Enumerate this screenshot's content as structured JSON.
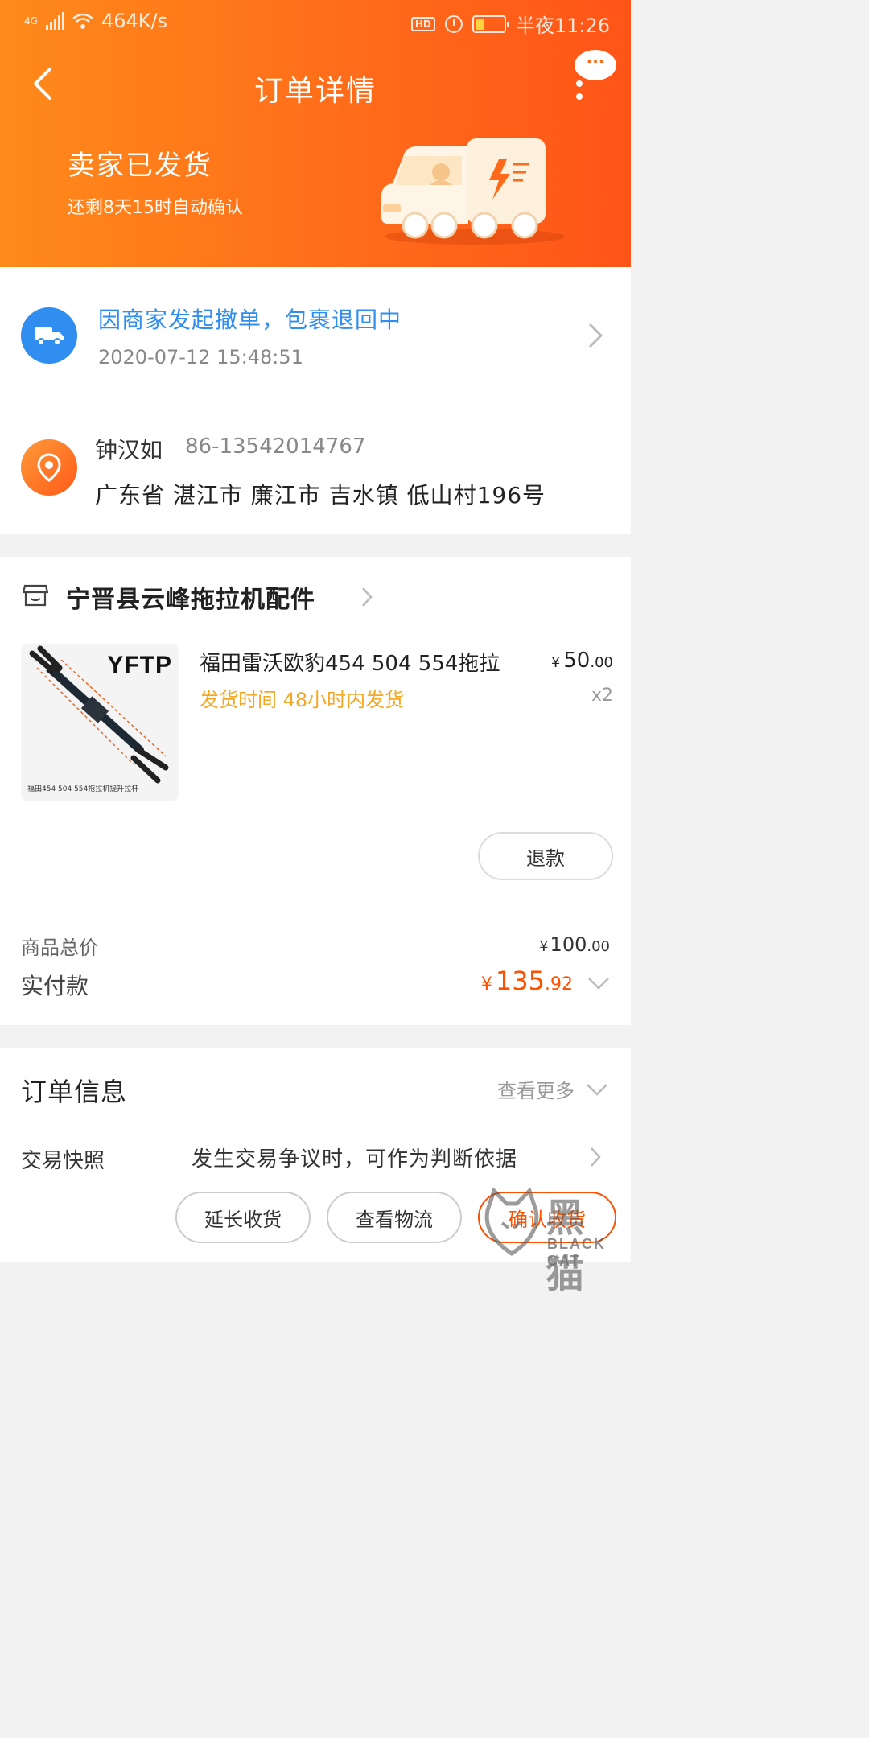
{
  "status_bar": {
    "network": "4G",
    "speed": "464K/s",
    "hd": "HD",
    "time": "半夜11:26"
  },
  "nav": {
    "title": "订单详情",
    "more_bubble": "···"
  },
  "shipping": {
    "status": "卖家已发货",
    "auto_confirm": "还剩8天15时自动确认"
  },
  "logistics": {
    "message": "因商家发起撤单，包裹退回中",
    "time": "2020-07-12 15:48:51"
  },
  "receiver": {
    "name": "钟汉如",
    "phone": "86-13542014767",
    "address": "广东省 湛江市 廉江市 吉水镇 低山村196号"
  },
  "shop": {
    "name": "宁晋县云峰拖拉机配件"
  },
  "product": {
    "image_brand": "YFTP",
    "image_caption": "福田454 504 554拖拉机提升拉杆",
    "name": "福田雷沃欧豹454 504 554拖拉",
    "ship_time": "发货时间 48小时内发货",
    "price_currency": "¥",
    "price_int": "50",
    "price_dec": ".00",
    "quantity": "x2"
  },
  "refund_label": "退款",
  "totals": {
    "goods_total_label": "商品总价",
    "goods_total_currency": "¥",
    "goods_total_int": "100",
    "goods_total_dec": ".00",
    "paid_label": "实付款",
    "paid_currency": "¥",
    "paid_int": "135",
    "paid_dec": ".92"
  },
  "order_info": {
    "title": "订单信息",
    "more": "查看更多",
    "snapshot_label": "交易快照",
    "snapshot_desc": "发生交易争议时，可作为判断依据"
  },
  "actions": {
    "extend": "延长收货",
    "logistics": "查看物流",
    "confirm": "确认收货"
  },
  "watermark": {
    "text": "黑猫",
    "sub": "BLACK CAT"
  },
  "colors": {
    "header_start": "#ff8a1a",
    "header_end": "#ff5418",
    "accent": "#ff5000",
    "link_blue": "#2f8ef0",
    "ship_time": "#f5a623"
  }
}
